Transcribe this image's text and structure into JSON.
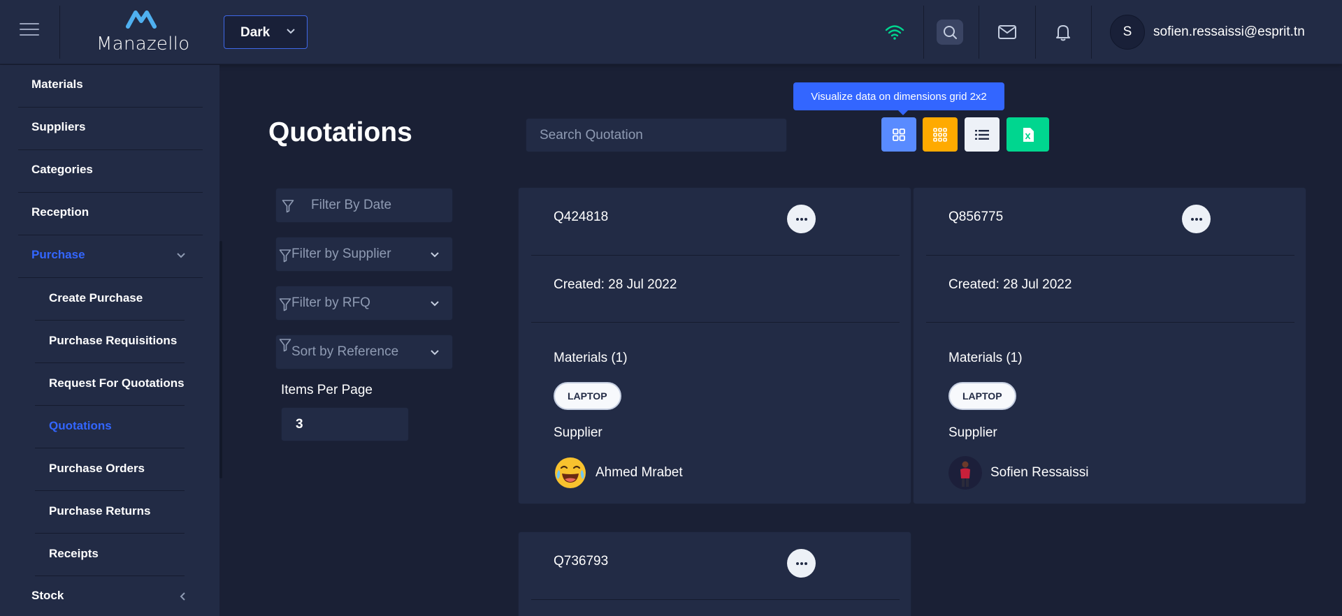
{
  "header": {
    "brand": "Manazello",
    "theme": "Dark",
    "user_initial": "S",
    "user_email": "sofien.ressaissi@esprit.tn",
    "icons": [
      "menu-icon",
      "wifi-icon",
      "search-icon",
      "mail-icon",
      "bell-icon"
    ]
  },
  "sidebar": {
    "items": [
      {
        "label": "Materials"
      },
      {
        "label": "Suppliers"
      },
      {
        "label": "Categories"
      },
      {
        "label": "Reception"
      },
      {
        "label": "Purchase",
        "expanded": true
      },
      {
        "label": "Stock"
      }
    ],
    "purchase_sub": [
      {
        "label": "Create Purchase"
      },
      {
        "label": "Purchase Requisitions"
      },
      {
        "label": "Request For Quotations"
      },
      {
        "label": "Quotations",
        "active": true
      },
      {
        "label": "Purchase Orders"
      },
      {
        "label": "Purchase Returns"
      },
      {
        "label": "Receipts"
      }
    ]
  },
  "main": {
    "title": "Quotations",
    "search_placeholder": "Search Quotation",
    "tooltip": "Visualize data on dimensions grid 2x2",
    "view_buttons": [
      "grid-2x2-icon",
      "grid-3x3-icon",
      "list-icon",
      "excel-icon"
    ],
    "filters": {
      "date": "Filter By Date",
      "supplier": "Filter by Supplier",
      "rfq": "Filter by RFQ",
      "sort": "Sort by Reference"
    },
    "items_per_page_label": "Items Per Page",
    "items_per_page": "3"
  },
  "quotations": [
    {
      "ref": "Q424818",
      "created": "Created: 28 Jul 2022",
      "materials": "Materials (1)",
      "tag": "LAPTOP",
      "supplier_label": "Supplier",
      "supplier": "Ahmed Mrabet"
    },
    {
      "ref": "Q856775",
      "created": "Created: 28 Jul 2022",
      "materials": "Materials (1)",
      "tag": "LAPTOP",
      "supplier_label": "Supplier",
      "supplier": "Sofien Ressaissi"
    },
    {
      "ref": "Q736793"
    }
  ],
  "colors": {
    "background": "#1a2035",
    "panel": "#222b45",
    "primary": "#3366ff",
    "warning": "#ffaa00",
    "success": "#00d68f"
  }
}
